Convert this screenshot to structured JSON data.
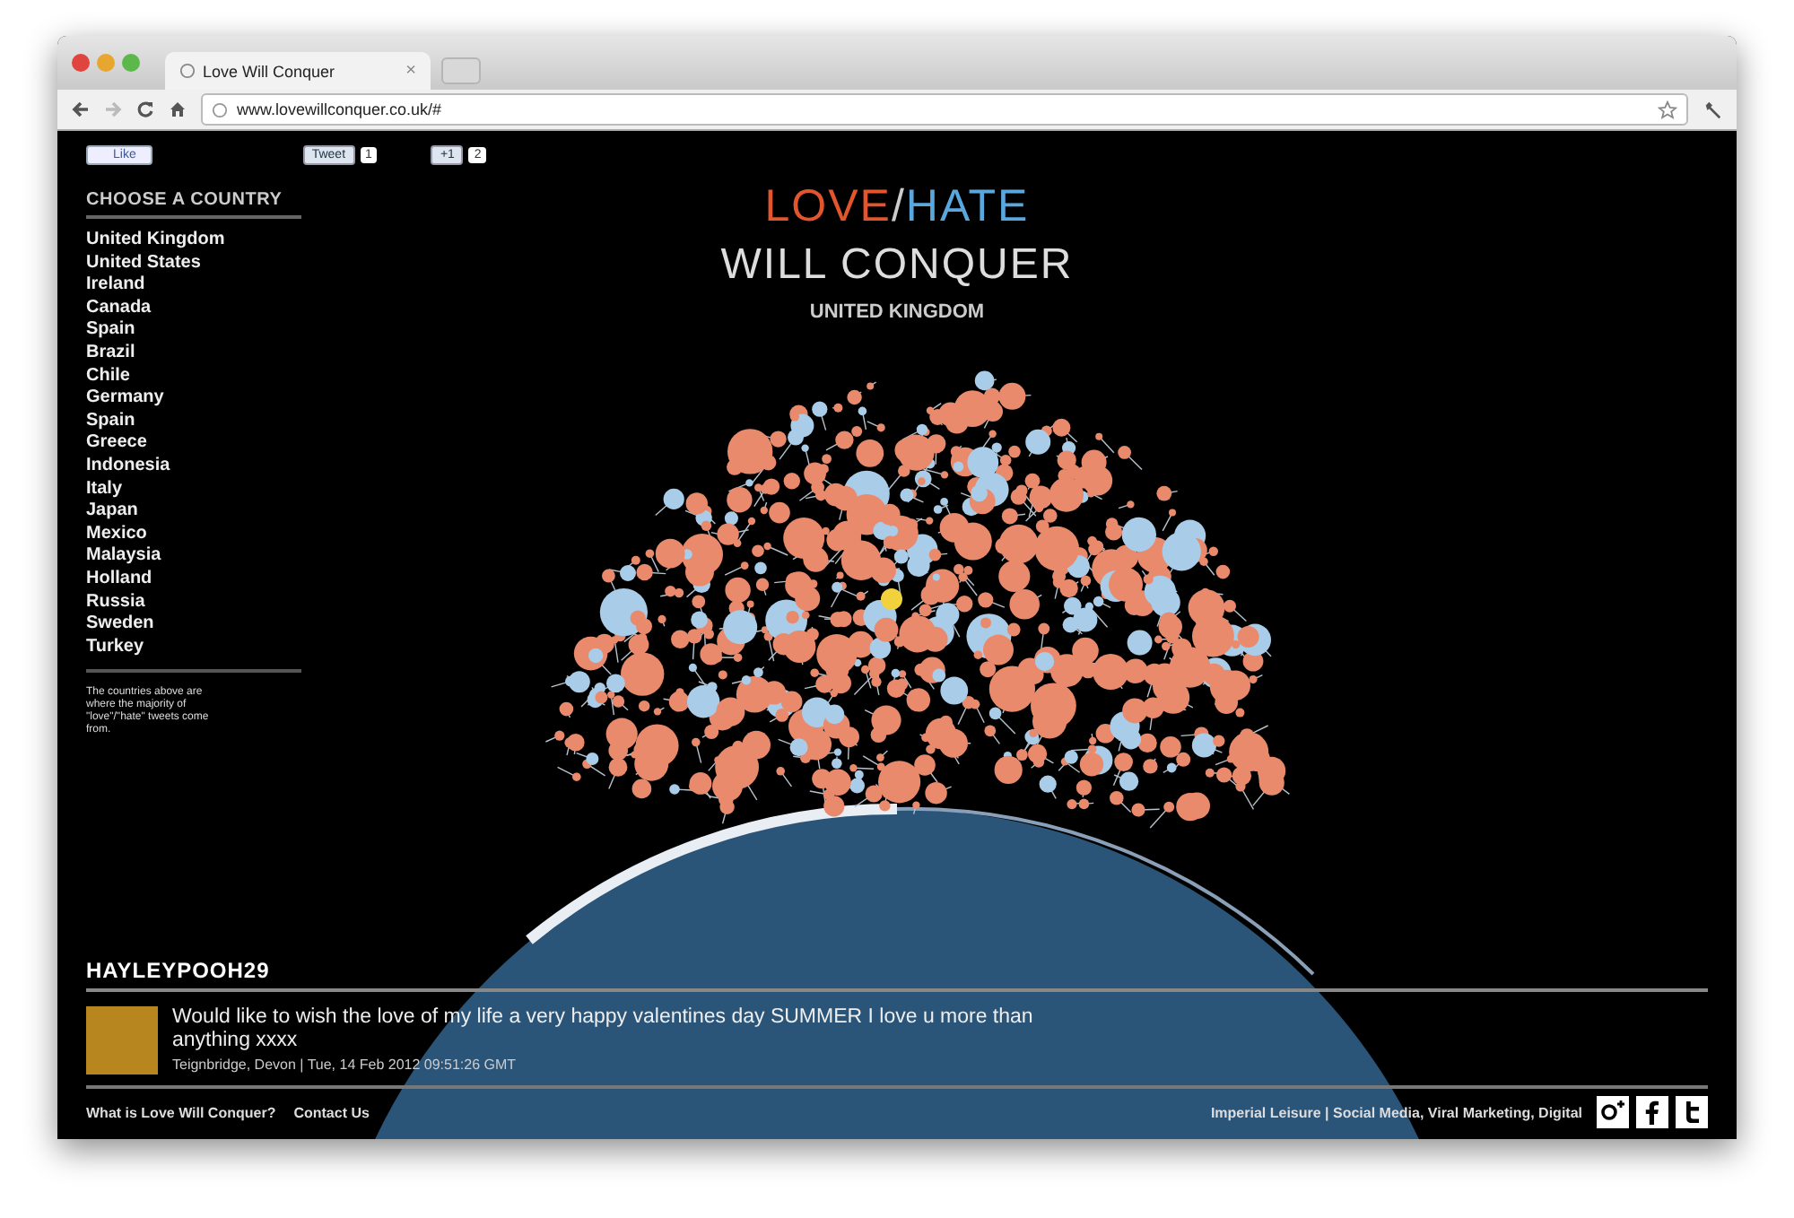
{
  "browser": {
    "tab_title": "Love Will Conquer",
    "url": "www.lovewillconquer.co.uk/#",
    "close_glyph": "×"
  },
  "social": {
    "like": "Like",
    "tweet": "Tweet",
    "tweet_count": "1",
    "plusone": "+1",
    "plusone_count": "2"
  },
  "sidebar": {
    "heading": "CHOOSE A COUNTRY",
    "countries": [
      "United Kingdom",
      "United States",
      "Ireland",
      "Canada",
      "Spain",
      "Brazil",
      "Chile",
      "Germany",
      "Spain",
      "Greece",
      "Indonesia",
      "Italy",
      "Japan",
      "Mexico",
      "Malaysia",
      "Holland",
      "Russia",
      "Sweden",
      "Turkey"
    ],
    "note": "The countries above are where the majority of \"love\"/\"hate\" tweets come from."
  },
  "header": {
    "love": "LOVE",
    "slash": "/",
    "hate": "HATE",
    "subtitle": "WILL CONQUER",
    "country": "UNITED KINGDOM"
  },
  "tweet": {
    "user": "HAYLEYPOOH29",
    "text": "Would like to wish the love of my life a very happy valentines day SUMMER I love u more than anything xxxx",
    "meta": "Teignbridge, Devon | Tue, 14 Feb 2012 09:51:26 GMT"
  },
  "footer": {
    "links": [
      "What is Love Will Conquer?",
      "Contact Us"
    ],
    "credit": "Imperial Leisure | Social Media, Viral Marketing, Digital",
    "icons": [
      {
        "kind": "google-plus"
      },
      {
        "kind": "facebook"
      },
      {
        "kind": "twitter"
      }
    ]
  }
}
